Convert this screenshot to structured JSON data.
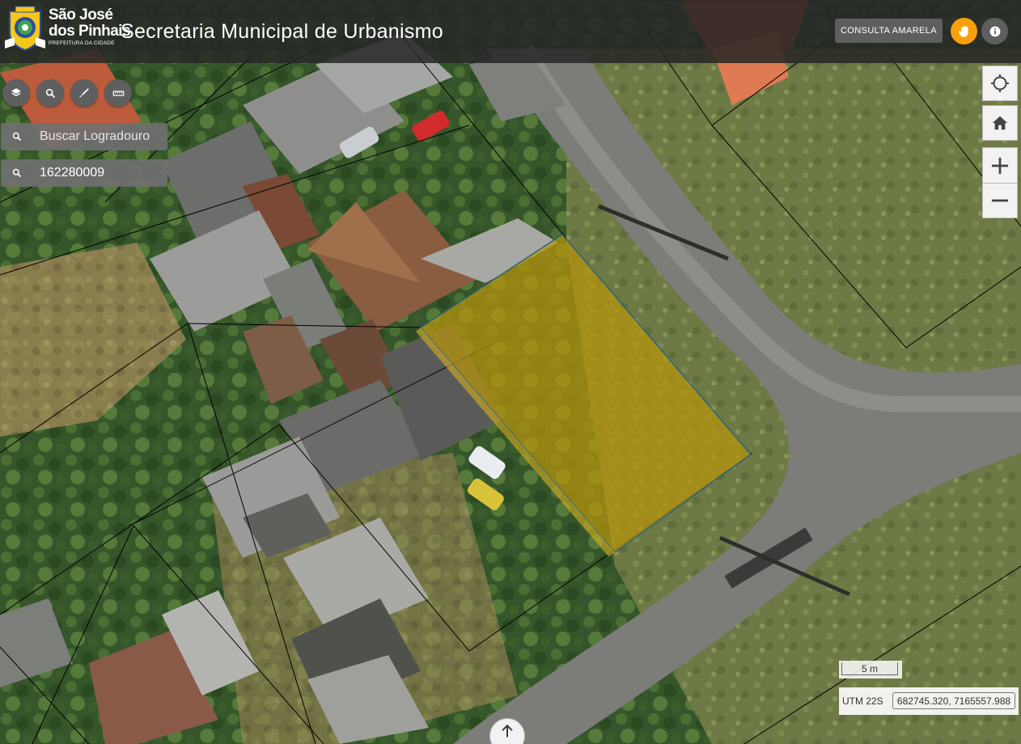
{
  "header": {
    "logo_line1": "São José",
    "logo_line2": "dos Pinhais",
    "logo_subtitle": "PREFEITURA DA CIDADE",
    "title": "Secretaria Municipal de Urbanismo",
    "consulta_label": "CONSULTA AMARELA",
    "hand_icon": "hand-icon",
    "info_icon": "info-icon"
  },
  "toolbar": {
    "layers_icon": "layers-icon",
    "search_icon": "search-icon",
    "draw_icon": "pencil-icon",
    "measure_icon": "ruler-icon"
  },
  "search": {
    "logradouro_placeholder": "Buscar Logradouro",
    "logradouro_value": "",
    "lote_value": "162280009"
  },
  "controls": {
    "locate_icon": "crosshair-icon",
    "home_icon": "home-icon",
    "zoom_in_icon": "plus-icon",
    "zoom_out_icon": "minus-icon",
    "north_icon": "north-arrow-icon"
  },
  "scale": {
    "label": "5 m"
  },
  "coordinates": {
    "projection": "UTM 22S",
    "value": "682745.320, 7165557.988"
  },
  "colors": {
    "header_bg": "#262626",
    "accent_orange": "#f7a00c",
    "button_gray": "#5e5e5e",
    "selected_parcel_fill": "#b8950d",
    "parcel_line": "#000000"
  }
}
